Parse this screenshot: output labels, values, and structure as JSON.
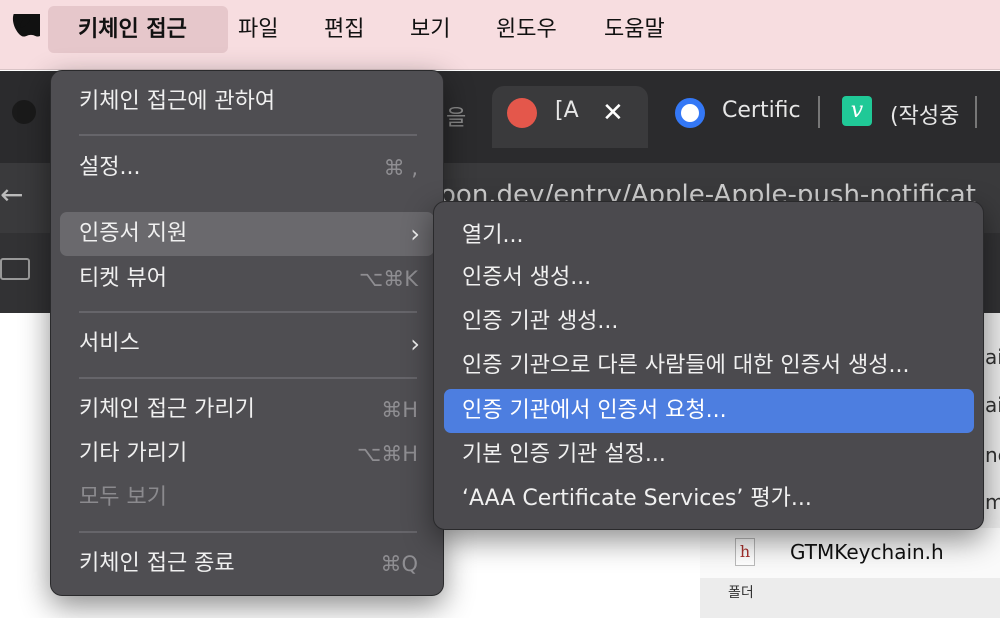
{
  "menubar": {
    "items": [
      {
        "label": "키체인 접근"
      },
      {
        "label": "파일"
      },
      {
        "label": "편집"
      },
      {
        "label": "보기"
      },
      {
        "label": "윈도우"
      },
      {
        "label": "도움말"
      }
    ]
  },
  "browser": {
    "tab_partial_label": "을",
    "active_tab_label": "[A",
    "tab2_label": "Certific",
    "tab3_label": "(작성중",
    "tab3_favicon_letter": "v",
    "url": "oon.dev/entry/Apple-Apple-push-notificat"
  },
  "app_menu": {
    "items": [
      {
        "label": "키체인 접근에 관하여",
        "shortcut": ""
      },
      {
        "label": "설정...",
        "shortcut": "⌘ ,"
      },
      {
        "label": "인증서 지원",
        "submenu": true
      },
      {
        "label": "티켓 뷰어",
        "shortcut": "⌥⌘K"
      },
      {
        "label": "서비스",
        "submenu": true
      },
      {
        "label": "키체인 접근 가리기",
        "shortcut": "⌘H"
      },
      {
        "label": "기타 가리기",
        "shortcut": "⌥⌘H"
      },
      {
        "label": "모두 보기",
        "shortcut": ""
      },
      {
        "label": "키체인 접근 종료",
        "shortcut": "⌘Q"
      }
    ]
  },
  "cert_submenu": {
    "items": [
      {
        "label": "열기..."
      },
      {
        "label": "인증서 생성..."
      },
      {
        "label": "인증 기관 생성..."
      },
      {
        "label": "인증 기관으로 다른 사람들에 대한 인증서 생성..."
      },
      {
        "label": "인증 기관에서 인증서 요청..."
      },
      {
        "label": "기본 인증 기관 설정..."
      },
      {
        "label": "‘AAA Certificate Services’ 평가..."
      }
    ],
    "selected_index": 4
  },
  "file_panel": {
    "file_name": "GTMKeychain.h",
    "file_icon_letter": "h",
    "folder_label": "폴더",
    "side_chars": [
      "ai",
      "ai",
      "ne",
      "m"
    ]
  },
  "colors": {
    "menubar_bg": "#f7dde0",
    "menu_bg": "#4f4e52",
    "selection": "#4d7ee0"
  }
}
